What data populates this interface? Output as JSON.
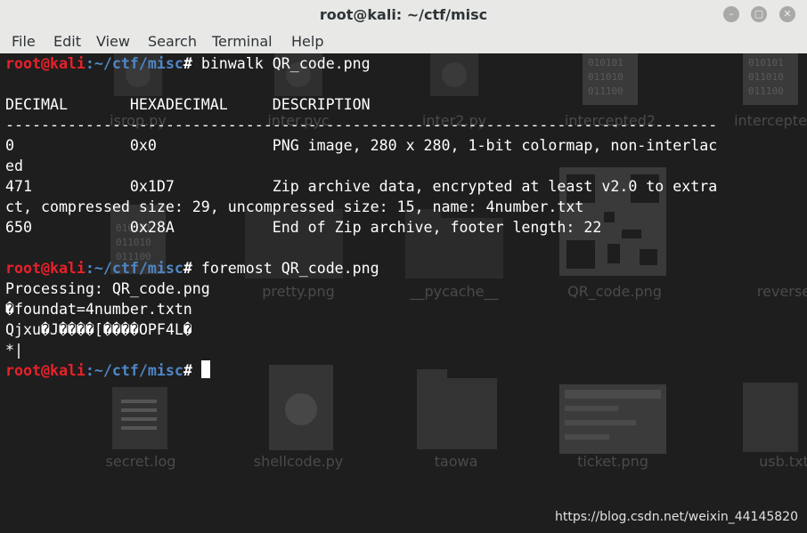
{
  "window": {
    "title": "root@kali: ~/ctf/misc",
    "minimize_glyph": "–",
    "maximize_glyph": "▢",
    "close_glyph": "✕"
  },
  "menu": [
    "File",
    "Edit",
    "View",
    "Search",
    "Terminal",
    "Help"
  ],
  "prompt": {
    "user": "root@kali",
    "path": ":~/ctf/misc",
    "symbol": "#"
  },
  "commands": {
    "c1": "binwalk QR_code.png",
    "c2": "foremost QR_code.png"
  },
  "output": {
    "header": "DECIMAL       HEXADECIMAL     DESCRIPTION",
    "rule": "--------------------------------------------------------------------------------",
    "r1a": "0             0x0             PNG image, 280 x 280, 1-bit colormap, non-interlac",
    "r1b": "ed",
    "r2a": "471           0x1D7           Zip archive data, encrypted at least v2.0 to extra",
    "r2b": "ct, compressed size: 29, uncompressed size: 15, name: 4number.txt",
    "r3": "650           0x28A           End of Zip archive, footer length: 22",
    "f1": "Processing: QR_code.png",
    "f2": "�foundat=4number.txtn",
    "f3": "Qjxu�J����[����OPF4L�",
    "f4": "*|"
  },
  "desktop_labels": {
    "d1": "isrop.py",
    "d2": "inter.pyc",
    "d3": "inter2.py",
    "d4": "intercepted2",
    "d5": "intercepte",
    "d6": "pretty.png",
    "d7": "__pycache__",
    "d8": "QR_code.png",
    "d9": "reverse",
    "d10": "secret.log",
    "d11": "shellcode.py",
    "d12": "taowa",
    "d13": "ticket.png",
    "d14": "usb.txt"
  },
  "watermark": "https://blog.csdn.net/weixin_44145820"
}
